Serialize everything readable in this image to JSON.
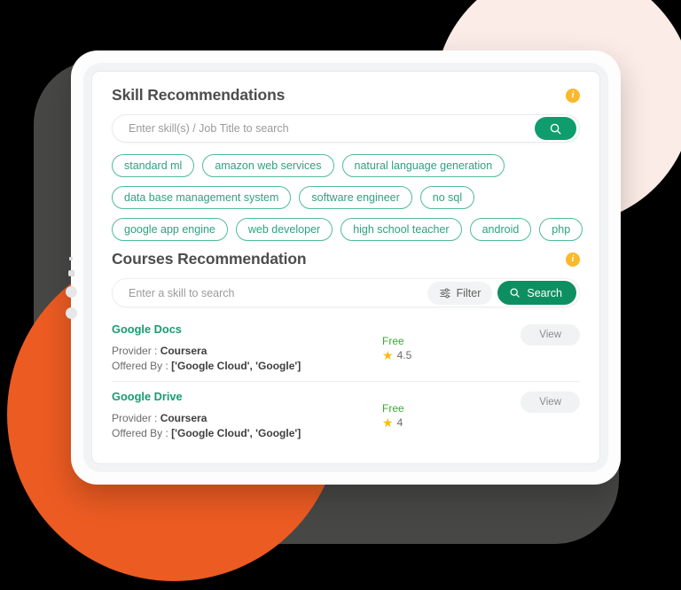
{
  "skills_section": {
    "title": "Skill Recommendations",
    "info_icon": "info-icon",
    "search": {
      "placeholder": "Enter skill(s) / Job Title to search",
      "value": "",
      "button_icon": "search-icon"
    },
    "chip_rows": [
      [
        "standard ml",
        "amazon web services",
        "natural language generation"
      ],
      [
        "data base management system",
        "software engineer",
        "no sql"
      ],
      [
        "google app engine",
        "web developer",
        "high school teacher",
        "android",
        "php"
      ]
    ]
  },
  "courses_section": {
    "title": "Courses Recommendation",
    "info_icon": "info-icon",
    "search": {
      "placeholder": "Enter a skill to search",
      "value": "",
      "filter_label": "Filter",
      "filter_icon": "sliders-icon",
      "search_label": "Search",
      "search_icon": "search-icon"
    },
    "labels": {
      "provider": "Provider : ",
      "offered_by": "Offered By : ",
      "view": "View"
    },
    "courses": [
      {
        "title": "Google Docs",
        "provider": "Coursera",
        "offered_by": "['Google Cloud', 'Google']",
        "price": "Free",
        "rating": "4.5",
        "star_icon": "star-icon",
        "action": "View"
      },
      {
        "title": "Google Drive",
        "provider": "Coursera",
        "offered_by": "['Google Cloud', 'Google']",
        "price": "Free",
        "rating": "4",
        "star_icon": "star-icon",
        "action": "View"
      }
    ]
  },
  "colors": {
    "brand_green": "#0e8f62",
    "chip_green": "#2fa183",
    "info_amber": "#fbb829",
    "star_gold": "#fcba14",
    "free_green": "#3aa935",
    "orange_circle": "#ec5b22",
    "pink_circle": "#fcece7",
    "dark_panel": "#474745",
    "heading_gray": "#4d4d4d"
  }
}
